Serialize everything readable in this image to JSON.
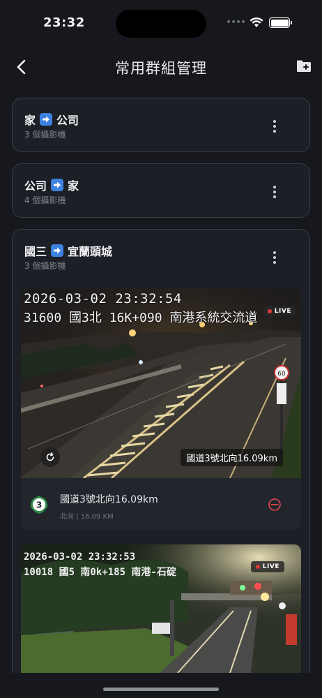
{
  "status_bar": {
    "time": "23:32"
  },
  "nav": {
    "title": "常用群組管理"
  },
  "groups": [
    {
      "from": "家",
      "to": "公司",
      "count_text": "3 個攝影機"
    },
    {
      "from": "公司",
      "to": "家",
      "count_text": "4 個攝影機"
    },
    {
      "from": "國三",
      "to": "宜蘭頭城",
      "count_text": "3 個攝影機"
    }
  ],
  "cameras": [
    {
      "overlay_datetime": "2026-03-02  23:32:54",
      "overlay_location": "31600  國3北  16K+090  南港系統交流道",
      "live_label": "LIVE",
      "location_tag": "國道3號北向16.09km",
      "name": "國道3號北向16.09km",
      "meta": "北向 | 16.09 KM",
      "highway_number": "3"
    },
    {
      "overlay_datetime": "2026-03-02  23:32:53",
      "overlay_location": "10018  國5  南0k+185  南港-石碇",
      "live_label": "LIVE"
    }
  ]
}
